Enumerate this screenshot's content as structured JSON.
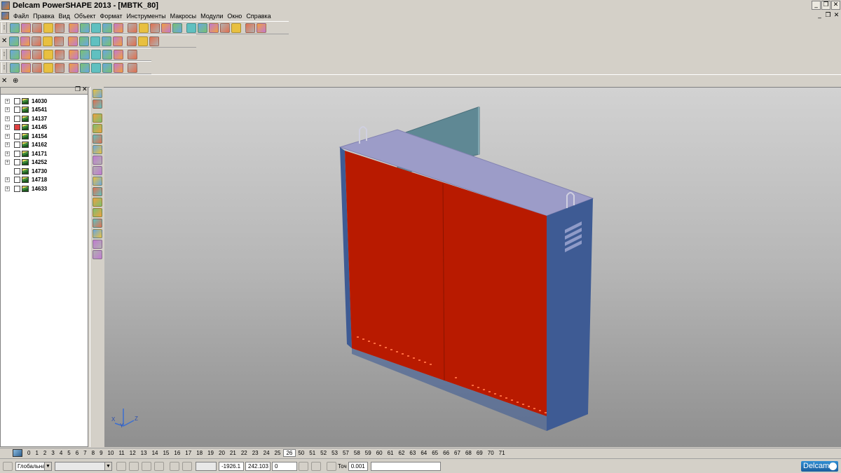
{
  "window": {
    "title": "Delcam PowerSHAPE 2013 - [MBTK_80]",
    "controls": {
      "minimize": "_",
      "restore": "❐",
      "close": "✕"
    },
    "mdi_controls": {
      "minimize": "_",
      "restore": "❐",
      "close": "✕"
    }
  },
  "menu": {
    "items": [
      "Файл",
      "Правка",
      "Вид",
      "Объект",
      "Формат",
      "Инструменты",
      "Макросы",
      "Модули",
      "Окно",
      "Справка"
    ]
  },
  "tree": {
    "header_buttons": {
      "restore": "❐",
      "close": "✕"
    },
    "items": [
      {
        "label": "14030",
        "expand": "+",
        "flag": "normal"
      },
      {
        "label": "14541",
        "expand": "+",
        "flag": "normal"
      },
      {
        "label": "14137",
        "expand": "+",
        "flag": "normal"
      },
      {
        "label": "14145",
        "expand": "+",
        "flag": "red"
      },
      {
        "label": "14154",
        "expand": "+",
        "flag": "normal"
      },
      {
        "label": "14162",
        "expand": "+",
        "flag": "normal"
      },
      {
        "label": "14171",
        "expand": "+",
        "flag": "normal"
      },
      {
        "label": "14252",
        "expand": "+",
        "flag": "normal"
      },
      {
        "label": "14730",
        "expand": "",
        "flag": "normal"
      },
      {
        "label": "14718",
        "expand": "+",
        "flag": "normal"
      },
      {
        "label": "14633",
        "expand": "+",
        "flag": "normal"
      }
    ]
  },
  "viewport": {
    "axis_labels": {
      "x": "X",
      "y": "Y",
      "z": "Z"
    },
    "colors": {
      "front_face": "#b81a00",
      "top_face": "#9c9cc8",
      "side_face": "#3e5b94",
      "rear_panel": "#5f8894",
      "slot_marks": "#ff6a3d"
    }
  },
  "layers": {
    "numbers": [
      "0",
      "1",
      "2",
      "3",
      "4",
      "5",
      "6",
      "7",
      "8",
      "9",
      "10",
      "11",
      "12",
      "13",
      "14",
      "15",
      "16",
      "17",
      "18",
      "19",
      "20",
      "21",
      "22",
      "23",
      "24",
      "25",
      "26",
      "50",
      "51",
      "52",
      "53",
      "57",
      "58",
      "59",
      "60",
      "61",
      "62",
      "63",
      "64",
      "65",
      "66",
      "67",
      "68",
      "69",
      "70",
      "71"
    ],
    "active": "26"
  },
  "status": {
    "workplane_select": "Глобальна",
    "coord_x": "-1926.1",
    "coord_y": "242.103",
    "coord_z": "0",
    "tolerance_label": "Точ",
    "tolerance_value": "0.001",
    "brand": "Delcam"
  }
}
